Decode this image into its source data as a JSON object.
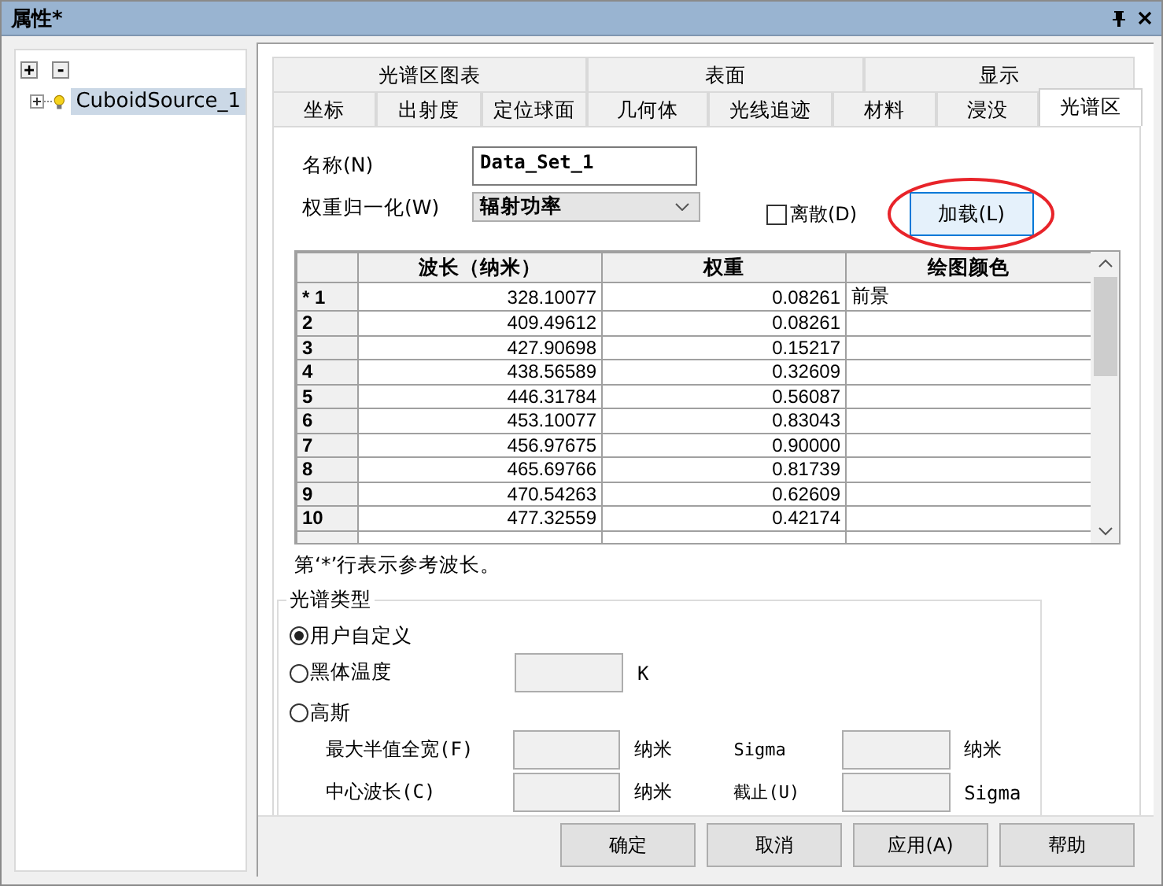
{
  "window": {
    "title": "属性*"
  },
  "tree": {
    "expand_all": "+",
    "collapse_all": "-",
    "items": [
      {
        "label": "CuboidSource_1",
        "selected": true,
        "expanded": false
      }
    ]
  },
  "upper_tabs": [
    {
      "label": "光谱区图表",
      "selected": false
    },
    {
      "label": "表面",
      "selected": false
    },
    {
      "label": "显示",
      "selected": false
    }
  ],
  "lower_tabs": [
    {
      "label": "坐标",
      "selected": false
    },
    {
      "label": "出射度",
      "selected": false
    },
    {
      "label": "定位球面",
      "selected": false
    },
    {
      "label": "几何体",
      "selected": false
    },
    {
      "label": "光线追迹",
      "selected": false
    },
    {
      "label": "材料",
      "selected": false
    },
    {
      "label": "浸没",
      "selected": false
    },
    {
      "label": "光谱区",
      "selected": true
    }
  ],
  "form": {
    "name": {
      "label": "名称(N)",
      "value": "Data_Set_1"
    },
    "weight_normalization": {
      "label": "权重归一化(W)",
      "value": "辐射功率"
    },
    "discrete": {
      "label": "离散(D)",
      "checked": false
    },
    "load_button": {
      "label": "加载(L)",
      "highlighted": true
    }
  },
  "table": {
    "columns": [
      "波长（纳米）",
      "权重",
      "绘图颜色"
    ],
    "rows": [
      {
        "header": "* 1",
        "wavelength": "328.10077",
        "weight": "0.08261",
        "plot_color": "前景"
      },
      {
        "header": "2",
        "wavelength": "409.49612",
        "weight": "0.08261"
      },
      {
        "header": "3",
        "wavelength": "427.90698",
        "weight": "0.15217"
      },
      {
        "header": "4",
        "wavelength": "438.56589",
        "weight": "0.32609"
      },
      {
        "header": "5",
        "wavelength": "446.31784",
        "weight": "0.56087"
      },
      {
        "header": "6",
        "wavelength": "453.10077",
        "weight": "0.83043"
      },
      {
        "header": "7",
        "wavelength": "456.97675",
        "weight": "0.90000"
      },
      {
        "header": "8",
        "wavelength": "465.69766",
        "weight": "0.81739"
      },
      {
        "header": "9",
        "wavelength": "470.54263",
        "weight": "0.62609"
      },
      {
        "header": "10",
        "wavelength": "477.32559",
        "weight": "0.42174"
      }
    ]
  },
  "note": "第‘*’行表示参考波长。",
  "spectral_type": {
    "title": "光谱类型",
    "options": [
      {
        "label": "用户自定义",
        "selected": true
      },
      {
        "label": "黑体温度",
        "selected": false
      },
      {
        "label": "高斯",
        "selected": false
      }
    ],
    "blackbody_unit": "K",
    "gaussian_rows": [
      {
        "label": "最大半值全宽(F)",
        "unit": "纳米",
        "label2": "Sigma",
        "unit2": "纳米"
      },
      {
        "label": "中心波长(C)",
        "unit": "纳米",
        "label2": "截止(U)",
        "unit2": "Sigma"
      }
    ]
  },
  "buttons": [
    "确定",
    "取消",
    "应用(A)",
    "帮助"
  ]
}
